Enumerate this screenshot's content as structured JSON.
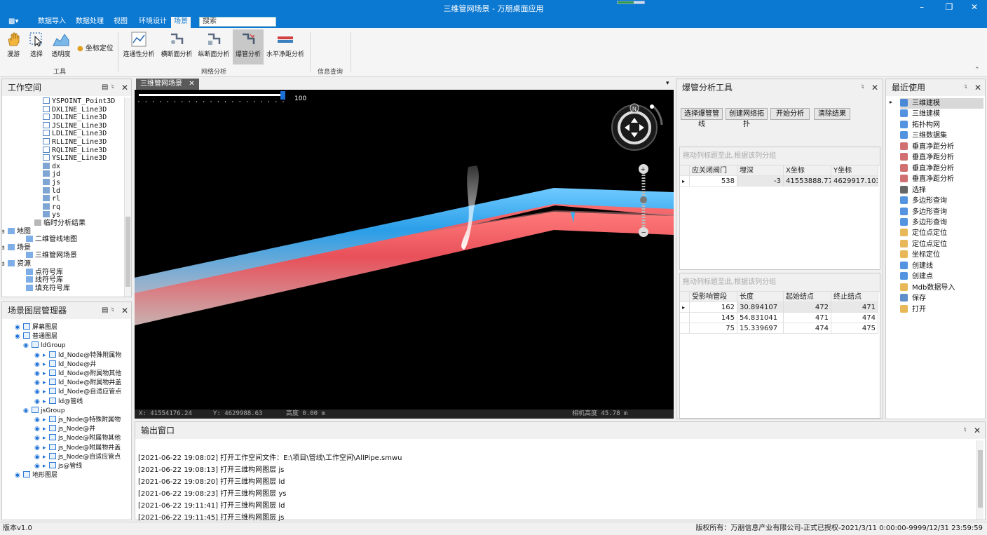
{
  "app": {
    "title": "三维管网场景 - 万朋桌面应用"
  },
  "menu": {
    "tabs": [
      "数据导入",
      "数据处理",
      "视图",
      "环境设计",
      "场景"
    ],
    "search_placeholder": "搜索"
  },
  "ribbon": {
    "tools": [
      "漫游",
      "选择",
      "透明度",
      "坐标定位"
    ],
    "network": [
      "连通性分析",
      "横断面分析",
      "纵断面分析",
      "爆管分析",
      "水平净距分析"
    ],
    "groups": {
      "tools": "工具",
      "network": "网络分析",
      "info": "信息查询"
    }
  },
  "workspace": {
    "title": "工作空间",
    "items": [
      "YSPOINT_Point3D",
      "DXLINE_Line3D",
      "JDLINE_Line3D",
      "JSLINE_Line3D",
      "LDLINE_Line3D",
      "RLLINE_Line3D",
      "RQLINE_Line3D",
      "YSLINE_Line3D",
      "dx",
      "jd",
      "js",
      "ld",
      "rl",
      "rq",
      "ys",
      "临时分析结果",
      "地图",
      "二维管线地图",
      "场景",
      "三维管网场景",
      "资源",
      "点符号库",
      "线符号库",
      "填充符号库"
    ]
  },
  "layers": {
    "title": "场景图层管理器",
    "items": [
      "屏幕图层",
      "普通图层",
      "ldGroup",
      "ld_Node@特殊附属物",
      "ld_Node@井",
      "ld_Node@附属物其他",
      "ld_Node@附属物井盖",
      "ld_Node@自适应管点",
      "ld@管线",
      "jsGroup",
      "js_Node@特殊附属物",
      "js_Node@井",
      "js_Node@附属物其他",
      "js_Node@附属物井盖",
      "js_Node@自适应管点",
      "js@管线",
      "地形图层"
    ]
  },
  "scene": {
    "tab": "三维管网场景",
    "slider_value": "100",
    "slider_fraction": 1.0,
    "status_x": "X: 41554176.24",
    "status_y": "Y: 4629988.63",
    "status_h": "高度 0.00 m",
    "status_cam": "相机高度 45.78 m"
  },
  "burst": {
    "title": "爆管分析工具",
    "buttons": [
      "选择爆管管线",
      "创建网络拓扑",
      "开始分析",
      "清除结果"
    ],
    "hint": "拖动列标题至此,根据该列分组",
    "valves": {
      "headers": [
        "应关闭阀门",
        "埋深",
        "X坐标",
        "Y坐标"
      ],
      "rows": [
        [
          "538",
          "-3",
          "41553888.77...",
          "4629917.103..."
        ]
      ]
    },
    "pipes": {
      "headers": [
        "受影响管段",
        "长度",
        "起始结点",
        "终止结点"
      ],
      "rows": [
        [
          "162",
          "30.894107",
          "472",
          "471"
        ],
        [
          "145",
          "54.831041",
          "471",
          "474"
        ],
        [
          "75",
          "15.339697",
          "474",
          "475"
        ]
      ]
    }
  },
  "recent": {
    "title": "最近使用",
    "items": [
      "三维建模",
      "三维建模",
      "拓扑构网",
      "三维数据集",
      "垂直净距分析",
      "垂直净距分析",
      "垂直净距分析",
      "垂直净距分析",
      "选择",
      "多边形查询",
      "多边形查询",
      "多边形查询",
      "定位点定位",
      "定位点定位",
      "坐标定位",
      "创建线",
      "创建点",
      "Mdb数据导入",
      "保存",
      "打开"
    ]
  },
  "output": {
    "title": "输出窗口",
    "lines": [
      "[2021-06-22 19:08:02] 打开工作空间文件：E:\\项目\\管线\\工作空间\\AllPipe.smwu",
      "[2021-06-22 19:08:13] 打开三维构网图层 js",
      "[2021-06-22 19:08:20] 打开三维构网图层 ld",
      "[2021-06-22 19:08:23] 打开三维构网图层 ys",
      "[2021-06-22 19:11:41] 打开三维构网图层 ld",
      "[2021-06-22 19:11:45] 打开三维构网图层 js"
    ]
  },
  "status": {
    "version": "版本v1.0",
    "copyright": "版权所有：万朋信息产业有限公司-正式已授权-2021/3/11 0:00:00-9999/12/31 23:59:59"
  },
  "colors": {
    "accent": "#0b78d1",
    "pipe_blue": "#35a8ea",
    "pipe_red": "#e8505a"
  }
}
